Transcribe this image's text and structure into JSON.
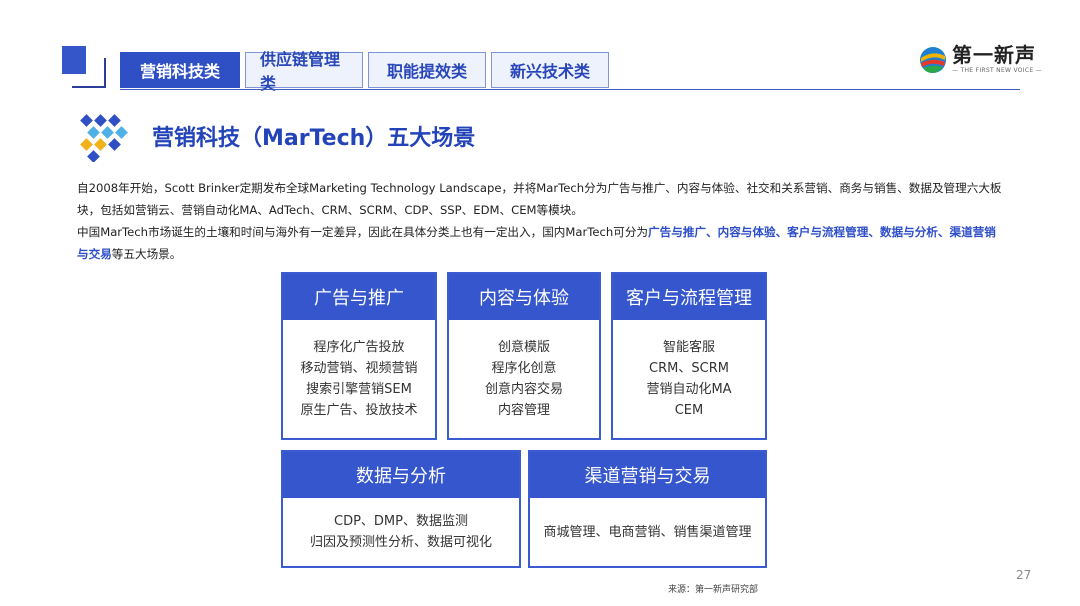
{
  "tabs": [
    {
      "label": "营销科技类",
      "active": true
    },
    {
      "label": "供应链管理类",
      "active": false
    },
    {
      "label": "职能提效类",
      "active": false
    },
    {
      "label": "新兴技术类",
      "active": false
    }
  ],
  "brand": {
    "name": "第一新声",
    "subtitle": "— THE FIRST NEW VOICE —"
  },
  "heading": {
    "title": "营销科技（MarTech）五大场景"
  },
  "intro": {
    "p1": "自2008年开始，Scott Brinker定期发布全球Marketing Technology Landscape，并将MarTech分为广告与推广、内容与体验、社交和关系营销、商务与销售、数据及管理六大板块，包括如营销云、营销自动化MA、AdTech、CRM、SCRM、CDP、SSP、EDM、CEM等模块。",
    "p2_prefix": "中国MarTech市场诞生的土壤和时间与海外有一定差异，因此在具体分类上也有一定出入，国内MarTech可分为",
    "p2_highlight": "广告与推广、内容与体验、客户与流程管理、数据与分析、渠道营销与交易",
    "p2_suffix": "等五大场景。"
  },
  "cards": [
    {
      "title": "广告与推广",
      "items": [
        "程序化广告投放",
        "移动营销、视频营销",
        "搜索引擎营销SEM",
        "原生广告、投放技术"
      ]
    },
    {
      "title": "内容与体验",
      "items": [
        "创意模版",
        "程序化创意",
        "创意内容交易",
        "内容管理"
      ]
    },
    {
      "title": "客户与流程管理",
      "items": [
        "智能客服",
        "CRM、SCRM",
        "营销自动化MA",
        "CEM"
      ]
    },
    {
      "title": "数据与分析",
      "items": [
        "CDP、DMP、数据监测",
        "归因及预测性分析、数据可视化"
      ]
    },
    {
      "title": "渠道营销与交易",
      "items": [
        "商城管理、电商营销、销售渠道管理"
      ]
    }
  ],
  "footer": {
    "source": "来源：第一新声研究部",
    "page_number": "27"
  },
  "colors": {
    "accent": "#3556cc",
    "highlight_text": "#2e4fc8",
    "tab_active_bg": "#2f50c5"
  },
  "icons": {
    "heading": "diamond-dots-icon",
    "brand": "brand-logo-icon"
  }
}
